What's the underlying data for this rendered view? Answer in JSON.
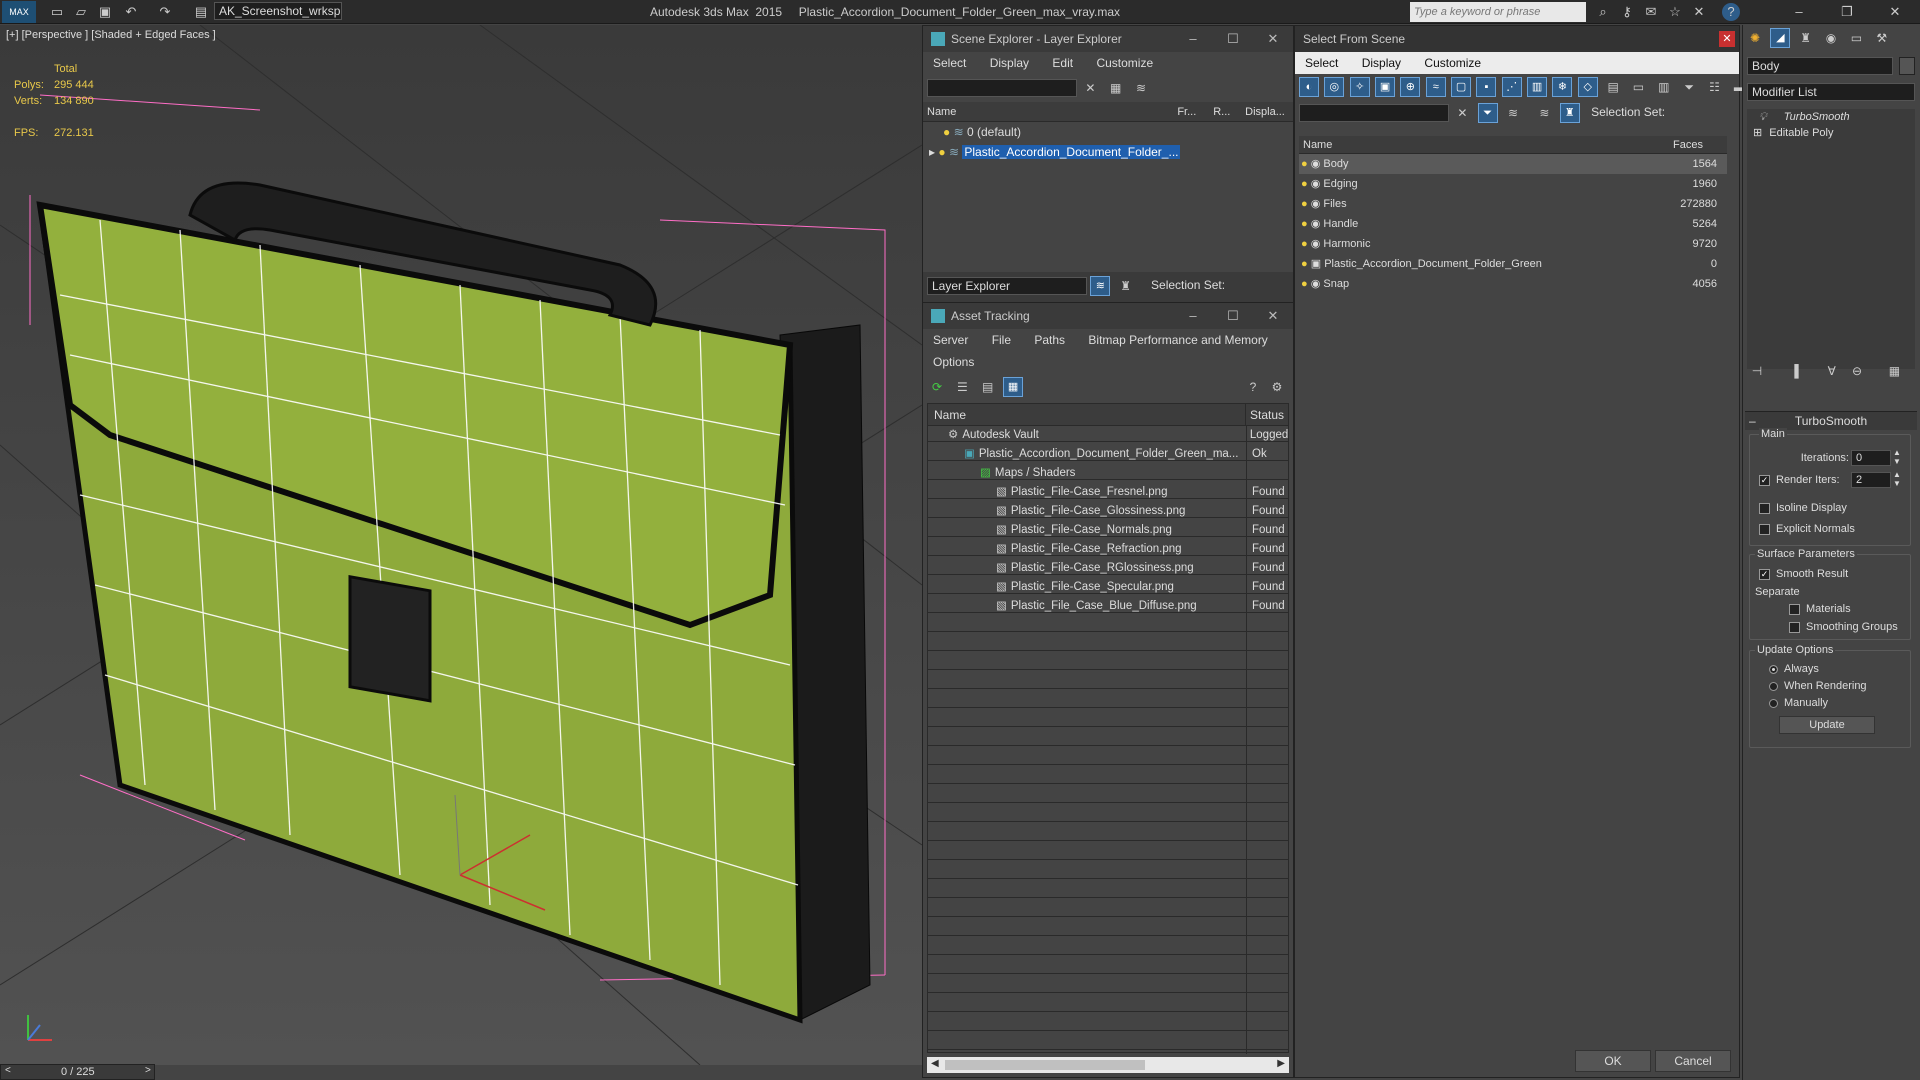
{
  "app": {
    "quick_access": "AK_Screenshot_wrksp",
    "title": "Autodesk 3ds Max  2015     Plastic_Accordion_Document_Folder_Green_max_vray.max",
    "search_placeholder": "Type a keyword or phrase"
  },
  "viewport": {
    "label": "[+] [Perspective ] [Shaded + Edged Faces ]",
    "stats_total": "Total",
    "polys_label": "Polys:",
    "polys_value": "295 444",
    "verts_label": "Verts:",
    "verts_value": "134 890",
    "fps_label": "FPS:",
    "fps_value": "272.131",
    "timeline": "0 / 225"
  },
  "scene_explorer": {
    "title": "Scene Explorer - Layer Explorer",
    "menu": [
      "Select",
      "Display",
      "Edit",
      "Customize"
    ],
    "columns": [
      "Name",
      "Fr...",
      "R...",
      "Displa..."
    ],
    "rows": [
      "0 (default)",
      "Plastic_Accordion_Document_Folder_..."
    ],
    "footer_dropdown": "Layer Explorer",
    "selection_set": "Selection Set:"
  },
  "asset_tracking": {
    "title": "Asset Tracking",
    "menu": [
      "Server",
      "File",
      "Paths",
      "Bitmap Performance and Memory"
    ],
    "menu2": "Options",
    "columns": [
      "Name",
      "Status"
    ],
    "rows": [
      {
        "name": "Autodesk Vault",
        "status": "Logged",
        "indent": 0
      },
      {
        "name": "Plastic_Accordion_Document_Folder_Green_ma...",
        "status": "Ok",
        "indent": 1
      },
      {
        "name": "Maps / Shaders",
        "status": "",
        "indent": 2
      },
      {
        "name": "Plastic_File-Case_Fresnel.png",
        "status": "Found",
        "indent": 3
      },
      {
        "name": "Plastic_File-Case_Glossiness.png",
        "status": "Found",
        "indent": 3
      },
      {
        "name": "Plastic_File-Case_Normals.png",
        "status": "Found",
        "indent": 3
      },
      {
        "name": "Plastic_File-Case_Refraction.png",
        "status": "Found",
        "indent": 3
      },
      {
        "name": "Plastic_File-Case_RGlossiness.png",
        "status": "Found",
        "indent": 3
      },
      {
        "name": "Plastic_File-Case_Specular.png",
        "status": "Found",
        "indent": 3
      },
      {
        "name": "Plastic_File_Case_Blue_Diffuse.png",
        "status": "Found",
        "indent": 3
      }
    ]
  },
  "select_from_scene": {
    "title": "Select From Scene",
    "menu": [
      "Select",
      "Display",
      "Customize"
    ],
    "selection_set": "Selection Set:",
    "columns": [
      "Name",
      "Faces"
    ],
    "rows": [
      {
        "name": "Body",
        "faces": "1564"
      },
      {
        "name": "Edging",
        "faces": "1960"
      },
      {
        "name": "Files",
        "faces": "272880"
      },
      {
        "name": "Handle",
        "faces": "5264"
      },
      {
        "name": "Harmonic",
        "faces": "9720"
      },
      {
        "name": "Plastic_Accordion_Document_Folder_Green",
        "faces": "0"
      },
      {
        "name": "Snap",
        "faces": "4056"
      }
    ],
    "ok": "OK",
    "cancel": "Cancel"
  },
  "modify_panel": {
    "object_name": "Body",
    "modifier_list": "Modifier List",
    "stack": [
      "TurboSmooth",
      "Editable Poly"
    ],
    "rollout_title": "TurboSmooth",
    "main": "Main",
    "iterations_label": "Iterations:",
    "iterations_value": "0",
    "render_iters_label": "Render Iters:",
    "render_iters_value": "2",
    "isoline": "Isoline Display",
    "explicit": "Explicit Normals",
    "surface": "Surface Parameters",
    "smooth_result": "Smooth Result",
    "separate": "Separate",
    "materials": "Materials",
    "smoothing_groups": "Smoothing Groups",
    "update_options": "Update Options",
    "always": "Always",
    "when_rendering": "When Rendering",
    "manually": "Manually",
    "update": "Update"
  }
}
